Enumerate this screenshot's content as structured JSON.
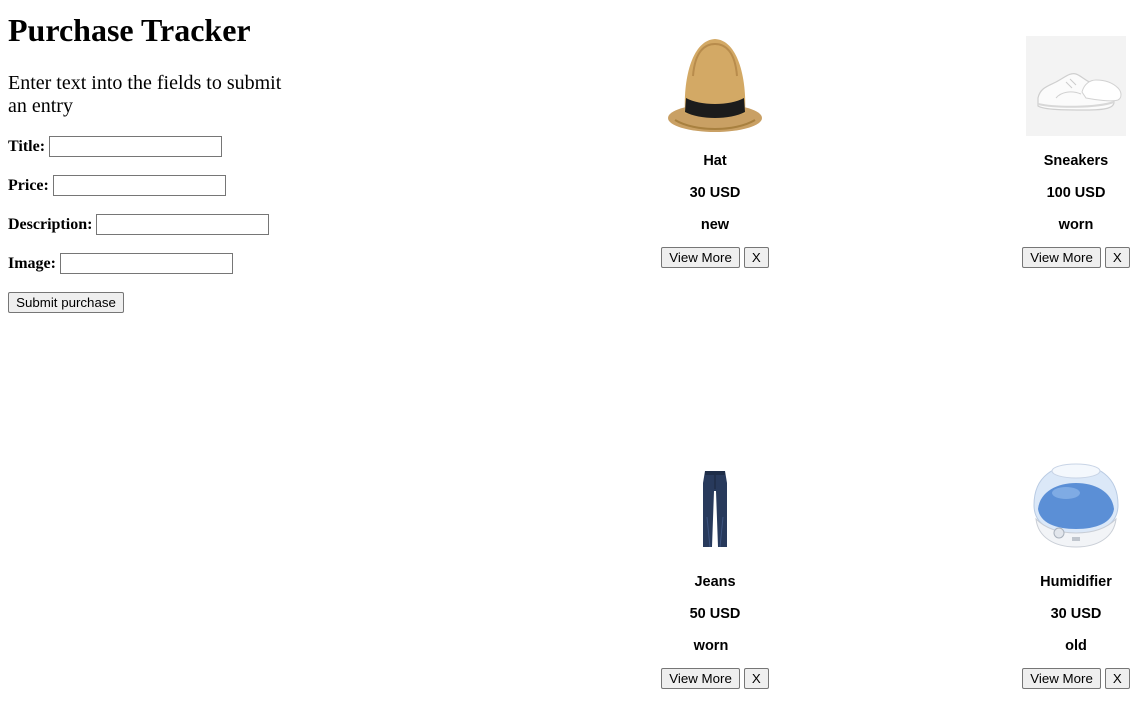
{
  "page": {
    "title": "Purchase Tracker",
    "subtitle": "Enter text into the fields to submit an entry"
  },
  "form": {
    "title_label": "Title:",
    "title_value": "",
    "price_label": "Price:",
    "price_value": "",
    "description_label": "Description:",
    "description_value": "",
    "image_label": "Image:",
    "image_value": "",
    "submit_label": "Submit purchase"
  },
  "products": [
    {
      "title": "Hat",
      "price": "30 USD",
      "condition": "new",
      "image": "straw-fedora-hat",
      "view_label": "View More",
      "delete_label": "X"
    },
    {
      "title": "Sneakers",
      "price": "100 USD",
      "condition": "worn",
      "image": "white-sneakers",
      "view_label": "View More",
      "delete_label": "X"
    },
    {
      "title": "Jeans",
      "price": "50 USD",
      "condition": "worn",
      "image": "blue-jeans",
      "view_label": "View More",
      "delete_label": "X"
    },
    {
      "title": "Humidifier",
      "price": "30 USD",
      "condition": "old",
      "image": "blue-humidifier",
      "view_label": "View More",
      "delete_label": "X"
    }
  ],
  "colors": {
    "button_bg": "#efefef",
    "button_border": "#767676",
    "input_border": "#767676"
  }
}
